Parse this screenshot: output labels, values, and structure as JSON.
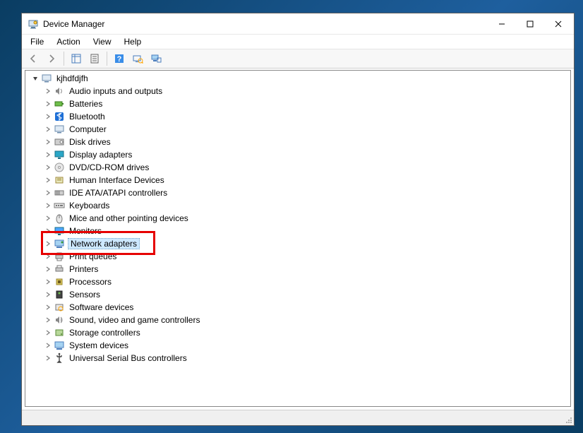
{
  "window": {
    "title": "Device Manager"
  },
  "menus": {
    "file": "File",
    "action": "Action",
    "view": "View",
    "help": "Help"
  },
  "tree": {
    "root_label": "kjhdfdjfh",
    "items": [
      {
        "label": "Audio inputs and outputs",
        "icon": "speaker-icon"
      },
      {
        "label": "Batteries",
        "icon": "battery-icon"
      },
      {
        "label": "Bluetooth",
        "icon": "bluetooth-icon"
      },
      {
        "label": "Computer",
        "icon": "computer-icon"
      },
      {
        "label": "Disk drives",
        "icon": "disk-icon"
      },
      {
        "label": "Display adapters",
        "icon": "display-icon"
      },
      {
        "label": "DVD/CD-ROM drives",
        "icon": "cd-icon"
      },
      {
        "label": "Human Interface Devices",
        "icon": "hid-icon"
      },
      {
        "label": "IDE ATA/ATAPI controllers",
        "icon": "ide-icon"
      },
      {
        "label": "Keyboards",
        "icon": "keyboard-icon"
      },
      {
        "label": "Mice and other pointing devices",
        "icon": "mouse-icon"
      },
      {
        "label": "Monitors",
        "icon": "monitor-icon"
      },
      {
        "label": "Network adapters",
        "icon": "network-icon",
        "selected": true,
        "highlighted": true
      },
      {
        "label": "Print queues",
        "icon": "printqueue-icon"
      },
      {
        "label": "Printers",
        "icon": "printer-icon"
      },
      {
        "label": "Processors",
        "icon": "cpu-icon"
      },
      {
        "label": "Sensors",
        "icon": "sensor-icon"
      },
      {
        "label": "Software devices",
        "icon": "software-icon"
      },
      {
        "label": "Sound, video and game controllers",
        "icon": "sound-icon"
      },
      {
        "label": "Storage controllers",
        "icon": "storage-icon"
      },
      {
        "label": "System devices",
        "icon": "system-icon"
      },
      {
        "label": "Universal Serial Bus controllers",
        "icon": "usb-icon"
      }
    ]
  },
  "colors": {
    "highlight_border": "#e60000",
    "selection_bg": "#cde8ff"
  }
}
